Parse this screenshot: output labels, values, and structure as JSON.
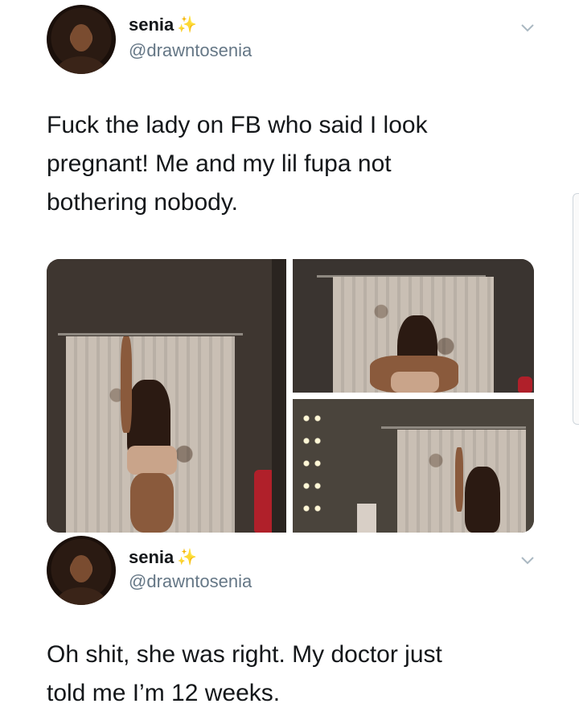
{
  "tweets": [
    {
      "author": {
        "name": "senia",
        "handle": "@drawntosenia",
        "badge_icon": "sparkles-icon"
      },
      "text_lines": [
        "Fuck the lady on FB who said I look",
        "pregnant! Me and my lil fupa not",
        "bothering nobody."
      ],
      "media": [
        {
          "description": "mirror-selfie-full"
        },
        {
          "description": "mirror-selfie-upper"
        },
        {
          "description": "mirror-selfie-back"
        }
      ]
    },
    {
      "author": {
        "name": "senia",
        "handle": "@drawntosenia",
        "badge_icon": "sparkles-icon"
      },
      "text_lines": [
        "Oh shit, she was right. My doctor just",
        "told me I’m 12 weeks."
      ]
    }
  ],
  "colors": {
    "name": "#14171a",
    "handle": "#657786",
    "sparkle": "#e8c547",
    "chevron": "#aab8c2"
  }
}
